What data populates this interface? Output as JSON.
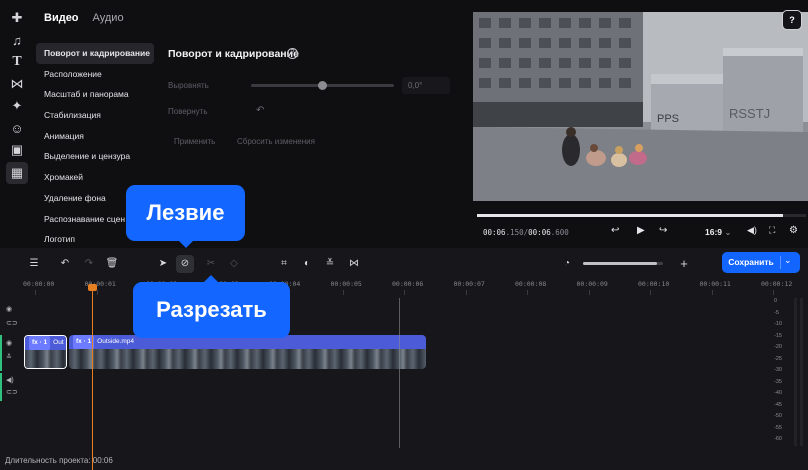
{
  "sidebar": {
    "rail_icons": [
      "plus-icon",
      "music-icon",
      "text-icon",
      "transitions-icon",
      "stickers-icon",
      "smiley-icon",
      "elements-icon",
      "tools-icon"
    ],
    "tabs": [
      {
        "label": "Видео",
        "active": true
      },
      {
        "label": "Аудио",
        "active": false
      }
    ],
    "items": [
      {
        "label": "Поворот и кадрирование",
        "active": true
      },
      {
        "label": "Расположение"
      },
      {
        "label": "Масштаб и панорама"
      },
      {
        "label": "Стабилизация"
      },
      {
        "label": "Анимация"
      },
      {
        "label": "Выделение и цензура"
      },
      {
        "label": "Хромакей"
      },
      {
        "label": "Удаление фона"
      },
      {
        "label": "Распознавание сцен"
      },
      {
        "label": "Логотип"
      }
    ]
  },
  "settings": {
    "title": "Поворот и кадрирование",
    "straighten_label": "Выровнять",
    "straighten_value": "0,0°",
    "straighten_level": 0.5,
    "rotate_label": "Повернуть",
    "apply_label": "Применить",
    "reset_label": "Сбросить изменения"
  },
  "preview": {
    "hint_icon": "?",
    "time_current": "00:06",
    "time_current_ms": ".150",
    "time_separator": "/",
    "time_total": "00:06",
    "time_total_ms": ".600",
    "progress": 0.93,
    "aspect_ratio": "16:9"
  },
  "toolbar": {
    "zoom_level": 0.92,
    "save_label": "Сохранить"
  },
  "ruler": {
    "labels": [
      "00:00:00",
      "00:00:01",
      "00:00:02",
      "00:00:03",
      "00:00:04",
      "00:00:05",
      "00:00:06",
      "00:00:07",
      "00:00:08",
      "00:00:09",
      "00:00:10",
      "00:00:11",
      "00:00:12"
    ]
  },
  "clips": [
    {
      "fx": "fx · 1",
      "name": "Out"
    },
    {
      "fx": "fx · 1",
      "name": "Outside.mp4"
    }
  ],
  "meter": {
    "labels": [
      "0",
      "-5",
      "-10",
      "-15",
      "-20",
      "-25",
      "-30",
      "-35",
      "-40",
      "-45",
      "-50",
      "-55",
      "-60"
    ]
  },
  "footer": {
    "duration": "Длительность проекта: 00:06"
  },
  "tooltips": {
    "razor": "Лезвие",
    "split": "Разрезать"
  },
  "colors": {
    "accent": "#1366ff",
    "playhead": "#e67e22",
    "clip": "#4c5bd8"
  }
}
